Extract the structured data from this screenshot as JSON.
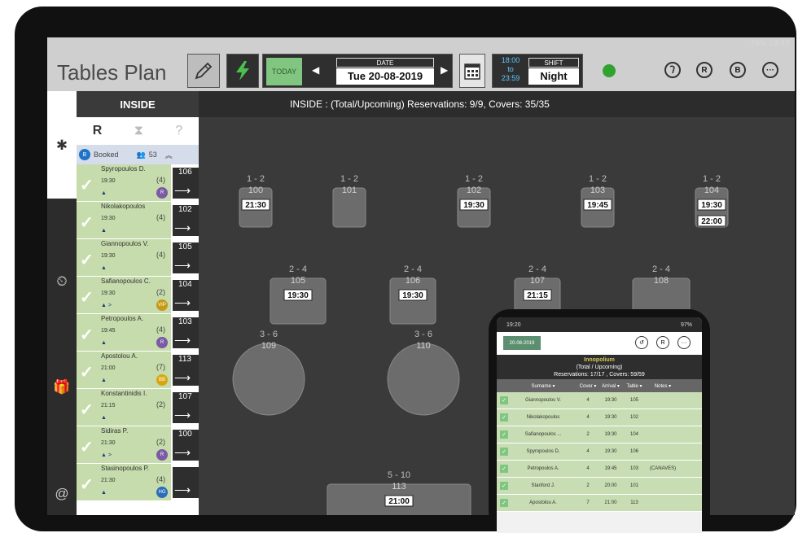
{
  "status_bar": "79% 18:57",
  "app": {
    "title": "Tables Plan"
  },
  "toolbar": {
    "today_label": "TODAY",
    "date_label": "DATE",
    "date_value": "Tue 20-08-2019",
    "shift_from": "18:00",
    "shift_to_word": "to",
    "shift_to": "23:59",
    "shift_label": "SHIFT",
    "shift_value": "Night",
    "icons": [
      "pencil-icon",
      "bolt-icon",
      "calendar-icon",
      "status-dot",
      "waitlist-icon",
      "reservation-icon",
      "booking-icon",
      "more-icon"
    ],
    "letter_r": "R",
    "letter_b": "B",
    "more": "···"
  },
  "panel": {
    "title": "INSIDE",
    "tab_r": "R",
    "tab_q": "?",
    "booked_label": "Booked",
    "booked_count": "53",
    "booked_badge": "B",
    "reservations": [
      {
        "name": "Spyropoulos D.",
        "time": "19:30",
        "covers": "(4)",
        "table": "106",
        "badge": "R",
        "badge_color": "#7b5aa6",
        "marks": ""
      },
      {
        "name": "Nikolakopoulos",
        "time": "19:30",
        "covers": "(4)",
        "table": "102",
        "badge": "",
        "badge_color": "",
        "marks": ""
      },
      {
        "name": "Giannopoulos V.",
        "time": "19:30",
        "covers": "(4)",
        "table": "105",
        "badge": "",
        "badge_color": "",
        "marks": ""
      },
      {
        "name": "Safianopoulos C.",
        "time": "19:30",
        "covers": "(2)",
        "table": "104",
        "badge": "VIP",
        "badge_color": "#c49a17",
        "marks": ">"
      },
      {
        "name": "Petropoulos A.",
        "time": "19:45",
        "covers": "(4)",
        "table": "103",
        "badge": "R",
        "badge_color": "#7b5aa6",
        "marks": ""
      },
      {
        "name": "Apostolou A.",
        "time": "21:00",
        "covers": "(7)",
        "table": "113",
        "badge": "BB",
        "badge_color": "#d8a60f",
        "marks": ""
      },
      {
        "name": "Konstantinidis I.",
        "time": "21:15",
        "covers": "(2)",
        "table": "107",
        "badge": "",
        "badge_color": "",
        "marks": ""
      },
      {
        "name": "Sidiras P.",
        "time": "21:30",
        "covers": "(2)",
        "table": "100",
        "badge": "R",
        "badge_color": "#7b5aa6",
        "marks": ">"
      },
      {
        "name": "Stasinopoulos P.",
        "time": "21:30",
        "covers": "(4)",
        "table": "",
        "badge": "HG",
        "badge_color": "#2b6db8",
        "marks": ""
      }
    ]
  },
  "floor": {
    "header": "INSIDE : (Total/Upcoming) Reservations: 9/9, Covers: 35/35",
    "tables": [
      {
        "id": "100",
        "cap": "1 - 2",
        "times": [
          "21:30"
        ]
      },
      {
        "id": "101",
        "cap": "1 - 2",
        "times": []
      },
      {
        "id": "102",
        "cap": "1 - 2",
        "times": [
          "19:30"
        ]
      },
      {
        "id": "103",
        "cap": "1 - 2",
        "times": [
          "19:45"
        ]
      },
      {
        "id": "104",
        "cap": "1 - 2",
        "times": [
          "19:30",
          "22:00"
        ]
      },
      {
        "id": "105",
        "cap": "2 - 4",
        "times": [
          "19:30"
        ]
      },
      {
        "id": "106",
        "cap": "2 - 4",
        "times": [
          "19:30"
        ]
      },
      {
        "id": "107",
        "cap": "2 - 4",
        "times": [
          "21:15"
        ]
      },
      {
        "id": "108",
        "cap": "2 - 4",
        "times": []
      },
      {
        "id": "109",
        "cap": "3 - 6",
        "times": []
      },
      {
        "id": "110",
        "cap": "3 - 6",
        "times": []
      },
      {
        "id": "113",
        "cap": "5 - 10",
        "times": [
          "21:00"
        ]
      }
    ]
  },
  "phone": {
    "status_time": "19:20",
    "status_batt": "97%",
    "date": "20-08-2019",
    "venue": "Innopolium",
    "subtitle": "(Total / Upcoming)",
    "summary": "Reservations: 17/17 , Covers: 59/59",
    "columns": [
      "Surname",
      "Cover",
      "Arrival",
      "Table",
      "Notes"
    ],
    "rows": [
      {
        "name": "Giannopoulos V.",
        "cover": "4",
        "arrival": "19:30",
        "table": "105",
        "notes": ""
      },
      {
        "name": "Nikolakopoulos",
        "cover": "4",
        "arrival": "19:30",
        "table": "102",
        "notes": ""
      },
      {
        "name": "Safianopoulos ...",
        "cover": "2",
        "arrival": "19:30",
        "table": "104",
        "notes": ""
      },
      {
        "name": "Spyropoulos D.",
        "cover": "4",
        "arrival": "19:30",
        "table": "106",
        "notes": ""
      },
      {
        "name": "Petropoulos A.",
        "cover": "4",
        "arrival": "19:45",
        "table": "103",
        "notes": "(CANAVES)"
      },
      {
        "name": "Stanford J.",
        "cover": "2",
        "arrival": "20:00",
        "table": "101",
        "notes": ""
      },
      {
        "name": "Apostolou A.",
        "cover": "7",
        "arrival": "21:00",
        "table": "113",
        "notes": ""
      }
    ]
  }
}
